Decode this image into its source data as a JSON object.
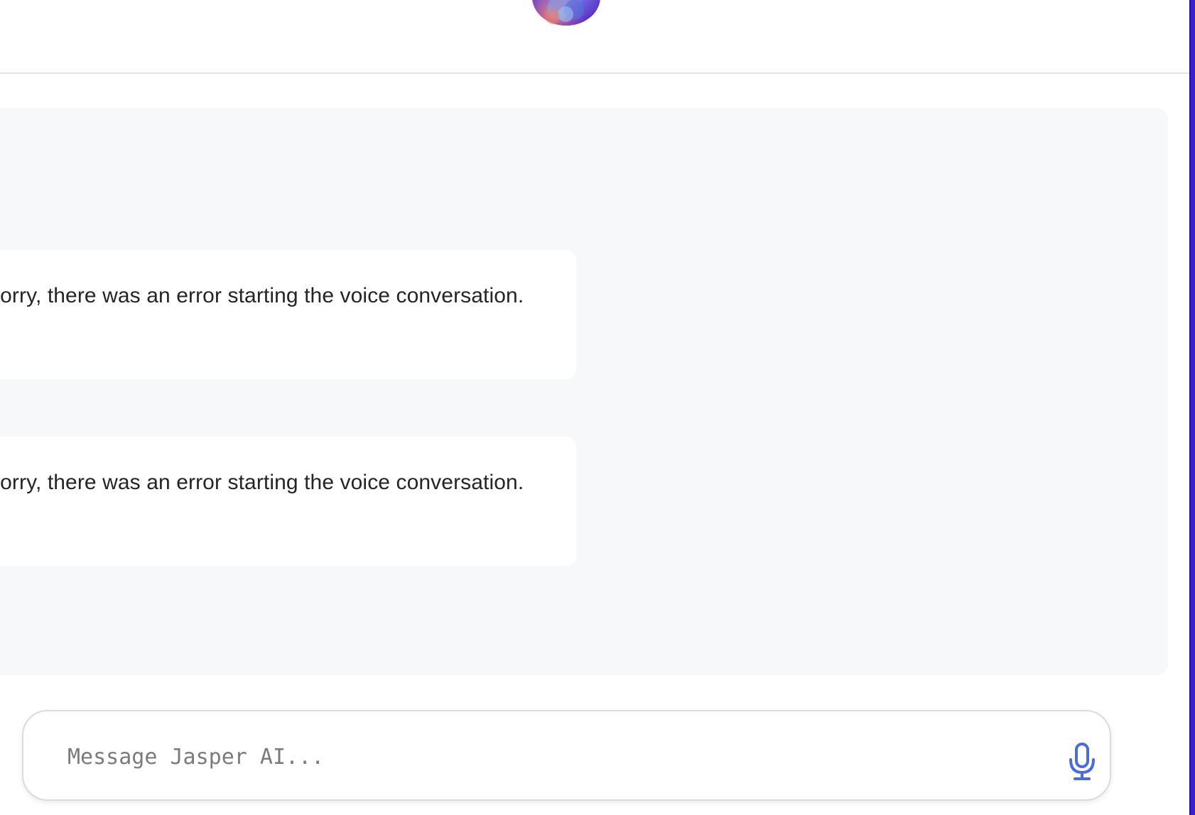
{
  "header": {
    "logo_icon": "jasper-orb-logo-icon"
  },
  "chat": {
    "messages": [
      {
        "text": "Sorry, there was an error starting the voice conversation."
      },
      {
        "text": "Sorry, there was an error starting the voice conversation."
      }
    ]
  },
  "composer": {
    "placeholder": "Message Jasper AI...",
    "value": "",
    "mic_icon": "microphone-icon"
  },
  "colors": {
    "accent": "#4a6be0",
    "panel_bg": "#f7f8fa",
    "right_edge": "#3a1fd0"
  }
}
